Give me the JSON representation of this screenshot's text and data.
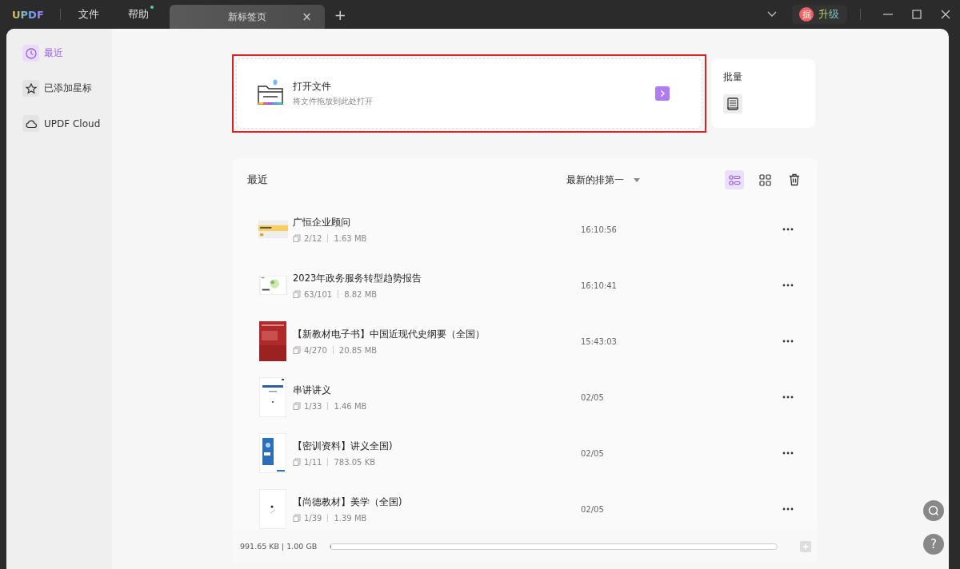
{
  "titlebar": {
    "logo": "UPDF",
    "menus": [
      {
        "label": "文件",
        "dot": false
      },
      {
        "label": "帮助",
        "dot": true
      }
    ],
    "tab": {
      "label": "新标签页",
      "close": "×"
    },
    "new_tab": "+",
    "avatar": "掘",
    "upgrade": "升级"
  },
  "sidebar": {
    "items": [
      {
        "label": "最近",
        "kind": "clock",
        "selected": true
      },
      {
        "label": "已添加星标",
        "kind": "star",
        "selected": false
      },
      {
        "label": "UPDF Cloud",
        "kind": "cloud",
        "selected": false
      }
    ]
  },
  "open_file": {
    "title": "打开文件",
    "hint": "将文件拖放到此处打开",
    "highlighted": true
  },
  "batch": {
    "title": "批量"
  },
  "recent": {
    "title": "最近",
    "sort": "最新的排第一",
    "views": [
      {
        "kind": "list",
        "selected": true
      },
      {
        "kind": "grid",
        "selected": false
      }
    ],
    "files": [
      {
        "name": "广恒企业顾问",
        "pages": "2/12",
        "size": "1.63 MB",
        "time": "16:10:56"
      },
      {
        "name": "2023年政务服务转型趋势报告",
        "pages": "63/101",
        "size": "8.82 MB",
        "time": "16:10:41"
      },
      {
        "name": "【新教材电子书】中国近现代史纲要（全国）",
        "pages": "4/270",
        "size": "20.85 MB",
        "time": "15:43:03"
      },
      {
        "name": "串讲讲义",
        "pages": "1/33",
        "size": "1.46 MB",
        "time": "02/05"
      },
      {
        "name": "【密训资料】讲义全国)",
        "pages": "1/11",
        "size": "783.05 KB",
        "time": "02/05"
      },
      {
        "name": "【尚德教材】美学（全国)",
        "pages": "1/39",
        "size": "1.39 MB",
        "time": "02/05"
      }
    ]
  },
  "storage": {
    "used": "991.65 KB | 1.00 GB",
    "level": 0.001
  },
  "help_button": "?"
}
